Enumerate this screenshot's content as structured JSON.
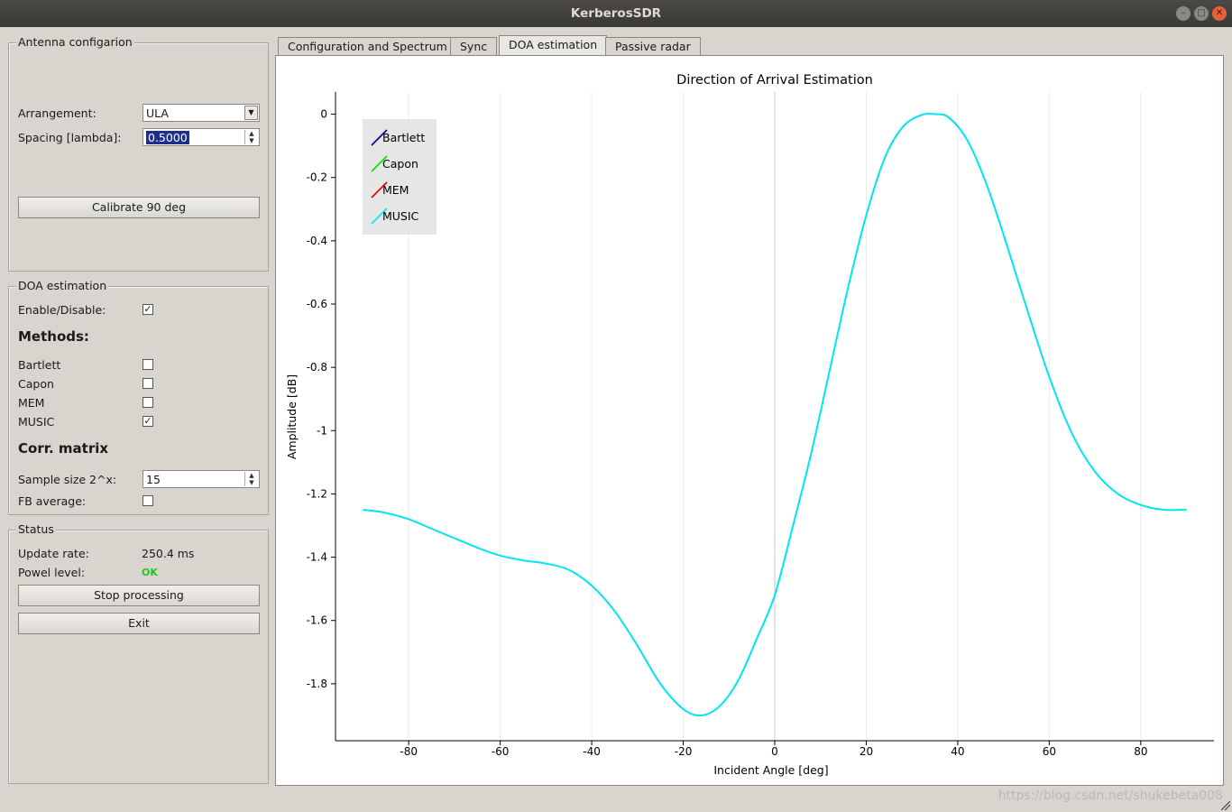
{
  "window": {
    "title": "KerberosSDR"
  },
  "antenna": {
    "group_title": "Antenna configarion",
    "arrangement_label": "Arrangement:",
    "arrangement_value": "ULA",
    "spacing_label": "Spacing [lambda]:",
    "spacing_value": "0.5000",
    "calibrate_label": "Calibrate 90 deg"
  },
  "doa": {
    "group_title": "DOA estimation",
    "enable_label": "Enable/Disable:",
    "enable_checked": true,
    "methods_heading": "Methods:",
    "methods": [
      {
        "label": "Bartlett",
        "checked": false
      },
      {
        "label": "Capon",
        "checked": false
      },
      {
        "label": "MEM",
        "checked": false
      },
      {
        "label": "MUSIC",
        "checked": true
      }
    ],
    "corr_heading": "Corr. matrix",
    "sample_label": "Sample size 2^x:",
    "sample_value": "15",
    "fb_label": "FB average:",
    "fb_checked": false
  },
  "status": {
    "group_title": "Status",
    "update_label": "Update rate:",
    "update_value": "250.4 ms",
    "power_label": "Powel level:",
    "power_value": "OK",
    "stop_label": "Stop processing",
    "exit_label": "Exit"
  },
  "tabs": [
    {
      "label": "Configuration and Spectrum",
      "active": false
    },
    {
      "label": "Sync",
      "active": false
    },
    {
      "label": "DOA estimation",
      "active": true
    },
    {
      "label": "Passive radar",
      "active": false
    }
  ],
  "watermark": "https://blog.csdn.net/shukebeta008",
  "colors": {
    "bartlett": "#00008b",
    "capon": "#00e000",
    "mem": "#e00000",
    "music": "#00e5ee"
  },
  "chart_data": {
    "type": "line",
    "title": "Direction of Arrival Estimation",
    "xlabel": "Incident Angle [deg]",
    "ylabel": "Amplitude [dB]",
    "xlim": [
      -96,
      96
    ],
    "ylim": [
      -1.98,
      0.07
    ],
    "xticks": [
      -80,
      -60,
      -40,
      -20,
      0,
      20,
      40,
      60,
      80
    ],
    "yticks": [
      0,
      -0.2,
      -0.4,
      -0.6,
      -0.8,
      -1,
      -1.2,
      -1.4,
      -1.6,
      -1.8
    ],
    "ytick_labels": [
      "0",
      "-0.2",
      "-0.4",
      "-0.6",
      "-0.8",
      "-1",
      "-1.2",
      "-1.4",
      "-1.6",
      "-1.8"
    ],
    "vertical_grid": true,
    "legend": [
      "Bartlett",
      "Capon",
      "MEM",
      "MUSIC"
    ],
    "legend_position": "top-left",
    "series": [
      {
        "name": "MUSIC",
        "x": [
          -90,
          -85,
          -80,
          -75,
          -70,
          -65,
          -60,
          -55,
          -50,
          -45,
          -40,
          -35,
          -30,
          -25,
          -20,
          -16,
          -12,
          -8,
          -4,
          0,
          4,
          8,
          12,
          16,
          20,
          24,
          28,
          32,
          35,
          38,
          42,
          46,
          50,
          55,
          60,
          65,
          70,
          75,
          80,
          85,
          90
        ],
        "y": [
          -1.25,
          -1.26,
          -1.28,
          -1.31,
          -1.34,
          -1.37,
          -1.395,
          -1.41,
          -1.42,
          -1.44,
          -1.49,
          -1.57,
          -1.68,
          -1.8,
          -1.88,
          -1.9,
          -1.87,
          -1.79,
          -1.66,
          -1.52,
          -1.3,
          -1.07,
          -0.81,
          -0.55,
          -0.32,
          -0.14,
          -0.04,
          -0.003,
          0.0,
          -0.01,
          -0.08,
          -0.21,
          -0.38,
          -0.61,
          -0.83,
          -1.01,
          -1.13,
          -1.2,
          -1.235,
          -1.25,
          -1.25
        ]
      }
    ]
  }
}
